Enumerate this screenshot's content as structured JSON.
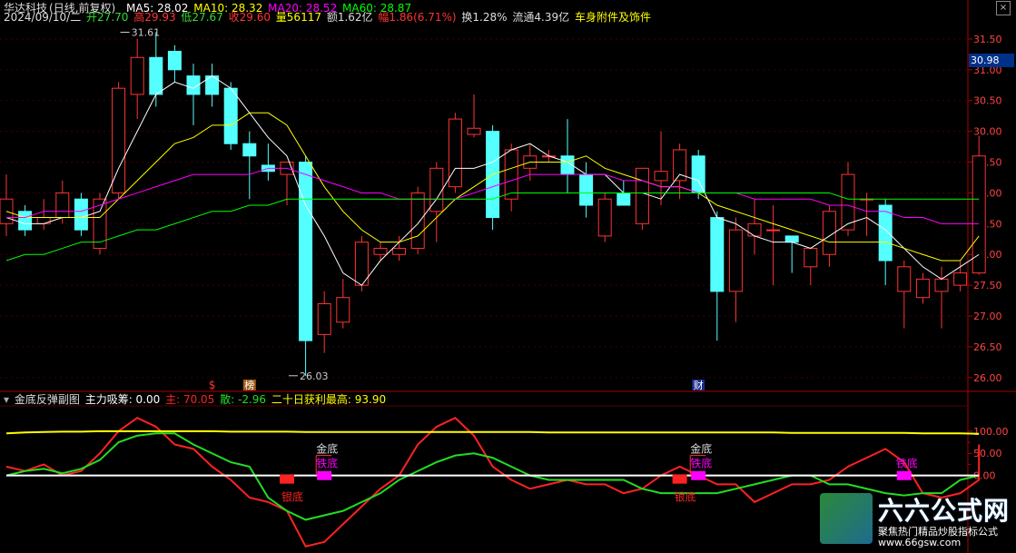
{
  "info_bar": {
    "stock_name": "华达科技",
    "mode": "(日线,前复权)",
    "ma5_label": "MA5: 28.02",
    "ma10_label": "MA10: 28.32",
    "ma20_label": "MA20: 28.52",
    "ma60_label": "MA60: 28.87",
    "date": "2024/09/10/二",
    "open": "开27.70",
    "high": "高29.93",
    "low": "低27.67",
    "close": "收29.60",
    "volume": "量56117",
    "amount": "额1.62亿",
    "change": "幅1.86(6.71%)",
    "turnover": "换1.28%",
    "float_cap": "流通4.39亿",
    "sector": "车身附件及饰件",
    "close_icon": "×"
  },
  "sub_bar": {
    "indicator": "金底反弹副图",
    "main_absorb": "主力吸筹: 0.00",
    "main": "主: 70.05",
    "scatter": "散: -2.96",
    "profit": "二十日获利最高: 93.90"
  },
  "current_price": "30.98",
  "markers": {
    "s_label": "$",
    "bang_label": "榜",
    "cai_label": "财"
  },
  "colors": {
    "up": "#ff3333",
    "down": "#54ffff",
    "ma5": "#ffffff",
    "ma10": "#ffff00",
    "ma20": "#ff00ff",
    "ma60": "#00ff00",
    "sub_red": "#ff2222",
    "sub_green": "#22dd22",
    "sub_yellow": "#ffff00",
    "sub_white": "#ffffff",
    "sub_magenta": "#ff00ff"
  },
  "watermark": {
    "title": "六六公式网",
    "subtitle": "聚焦热门精品炒股指标公式",
    "url": "www.66gsw.com"
  },
  "chart_data": [
    {
      "type": "candlestick",
      "y_ticks": [
        "31.50",
        "31.00",
        "30.50",
        "30.00",
        "29.50",
        "29.00",
        "28.50",
        "28.00",
        "27.50",
        "27.00",
        "26.50",
        "26.00"
      ],
      "ylim": [
        25.85,
        31.75
      ],
      "annotations": [
        {
          "text": "31.61",
          "candle": 6,
          "value": 31.61
        },
        {
          "text": "26.03",
          "candle": 15,
          "value": 26.03
        }
      ],
      "candles": [
        {
          "o": 28.5,
          "h": 29.3,
          "l": 28.3,
          "c": 28.9
        },
        {
          "o": 28.7,
          "h": 28.8,
          "l": 28.3,
          "c": 28.4
        },
        {
          "o": 28.5,
          "h": 28.9,
          "l": 28.4,
          "c": 28.6
        },
        {
          "o": 28.6,
          "h": 29.2,
          "l": 28.5,
          "c": 29.0
        },
        {
          "o": 28.9,
          "h": 29.0,
          "l": 28.3,
          "c": 28.4
        },
        {
          "o": 28.1,
          "h": 29.0,
          "l": 28.0,
          "c": 28.9
        },
        {
          "o": 29.0,
          "h": 30.8,
          "l": 28.9,
          "c": 30.7
        },
        {
          "o": 30.6,
          "h": 31.5,
          "l": 30.2,
          "c": 31.2
        },
        {
          "o": 31.2,
          "h": 31.61,
          "l": 30.4,
          "c": 30.6
        },
        {
          "o": 31.3,
          "h": 31.4,
          "l": 30.8,
          "c": 31.0
        },
        {
          "o": 30.9,
          "h": 31.1,
          "l": 30.1,
          "c": 30.6
        },
        {
          "o": 30.9,
          "h": 31.1,
          "l": 30.4,
          "c": 30.6
        },
        {
          "o": 30.7,
          "h": 30.8,
          "l": 29.7,
          "c": 29.8
        },
        {
          "o": 29.8,
          "h": 30.0,
          "l": 28.9,
          "c": 29.6
        },
        {
          "o": 29.45,
          "h": 29.8,
          "l": 29.2,
          "c": 29.35
        },
        {
          "o": 29.3,
          "h": 29.5,
          "l": 28.8,
          "c": 29.5
        },
        {
          "o": 29.5,
          "h": 29.6,
          "l": 26.03,
          "c": 26.6
        },
        {
          "o": 26.7,
          "h": 27.4,
          "l": 26.4,
          "c": 27.2
        },
        {
          "o": 26.9,
          "h": 27.6,
          "l": 26.8,
          "c": 27.3
        },
        {
          "o": 27.5,
          "h": 28.3,
          "l": 27.4,
          "c": 28.2
        },
        {
          "o": 28.0,
          "h": 28.2,
          "l": 27.9,
          "c": 28.1
        },
        {
          "o": 28.0,
          "h": 28.3,
          "l": 27.9,
          "c": 28.1
        },
        {
          "o": 28.1,
          "h": 29.1,
          "l": 28.0,
          "c": 29.0
        },
        {
          "o": 28.7,
          "h": 29.5,
          "l": 28.2,
          "c": 29.4
        },
        {
          "o": 29.1,
          "h": 30.3,
          "l": 29.0,
          "c": 30.2
        },
        {
          "o": 29.95,
          "h": 30.6,
          "l": 29.9,
          "c": 30.05
        },
        {
          "o": 30.0,
          "h": 30.1,
          "l": 28.4,
          "c": 28.6
        },
        {
          "o": 28.9,
          "h": 29.8,
          "l": 28.7,
          "c": 29.7
        },
        {
          "o": 29.4,
          "h": 29.8,
          "l": 29.2,
          "c": 29.6
        },
        {
          "o": 29.6,
          "h": 29.7,
          "l": 29.5,
          "c": 29.6
        },
        {
          "o": 29.6,
          "h": 30.2,
          "l": 29.0,
          "c": 29.3
        },
        {
          "o": 29.3,
          "h": 29.5,
          "l": 28.6,
          "c": 28.8
        },
        {
          "o": 28.3,
          "h": 29.0,
          "l": 28.2,
          "c": 28.9
        },
        {
          "o": 29.0,
          "h": 29.2,
          "l": 28.8,
          "c": 28.8
        },
        {
          "o": 28.5,
          "h": 29.4,
          "l": 28.4,
          "c": 29.4
        },
        {
          "o": 29.2,
          "h": 30.0,
          "l": 28.8,
          "c": 29.35
        },
        {
          "o": 29.2,
          "h": 29.8,
          "l": 28.9,
          "c": 29.7
        },
        {
          "o": 29.6,
          "h": 29.7,
          "l": 28.9,
          "c": 29.0
        },
        {
          "o": 28.6,
          "h": 28.7,
          "l": 26.6,
          "c": 27.4
        },
        {
          "o": 27.4,
          "h": 28.6,
          "l": 26.9,
          "c": 28.4
        },
        {
          "o": 28.3,
          "h": 28.9,
          "l": 28.0,
          "c": 28.5
        },
        {
          "o": 28.4,
          "h": 28.8,
          "l": 27.5,
          "c": 28.4
        },
        {
          "o": 28.3,
          "h": 28.3,
          "l": 27.7,
          "c": 28.2
        },
        {
          "o": 27.8,
          "h": 28.1,
          "l": 27.5,
          "c": 28.1
        },
        {
          "o": 28.0,
          "h": 28.8,
          "l": 27.8,
          "c": 28.7
        },
        {
          "o": 28.4,
          "h": 29.5,
          "l": 28.3,
          "c": 29.3
        },
        {
          "o": 28.9,
          "h": 29.0,
          "l": 28.3,
          "c": 28.9
        },
        {
          "o": 28.8,
          "h": 28.9,
          "l": 27.5,
          "c": 27.9
        },
        {
          "o": 27.4,
          "h": 27.9,
          "l": 26.8,
          "c": 27.8
        },
        {
          "o": 27.3,
          "h": 27.7,
          "l": 27.2,
          "c": 27.6
        },
        {
          "o": 27.4,
          "h": 27.8,
          "l": 26.8,
          "c": 27.6
        },
        {
          "o": 27.5,
          "h": 27.9,
          "l": 27.4,
          "c": 27.7
        },
        {
          "o": 27.7,
          "h": 29.93,
          "l": 27.67,
          "c": 29.6
        }
      ],
      "series": [
        {
          "name": "MA5",
          "values": [
            28.6,
            28.5,
            28.5,
            28.6,
            28.6,
            28.7,
            29.4,
            30.0,
            30.6,
            30.8,
            30.7,
            30.9,
            30.7,
            30.3,
            29.9,
            29.6,
            28.8,
            28.3,
            27.7,
            27.5,
            27.9,
            28.2,
            28.5,
            28.9,
            29.4,
            29.4,
            29.5,
            29.7,
            29.8,
            29.6,
            29.5,
            29.3,
            29.3,
            29.0,
            29.0,
            28.9,
            29.3,
            29.2,
            28.6,
            28.5,
            28.3,
            28.2,
            28.2,
            28.1,
            28.3,
            28.5,
            28.6,
            28.4,
            28.1,
            27.8,
            27.6,
            27.8,
            28.0
          ]
        },
        {
          "name": "MA10",
          "values": [
            28.7,
            28.6,
            28.6,
            28.6,
            28.6,
            28.6,
            28.9,
            29.2,
            29.5,
            29.8,
            29.9,
            30.1,
            30.1,
            30.3,
            30.3,
            30.1,
            29.6,
            29.1,
            28.7,
            28.4,
            28.2,
            28.2,
            28.3,
            28.6,
            28.9,
            29.1,
            29.3,
            29.4,
            29.5,
            29.5,
            29.5,
            29.6,
            29.4,
            29.3,
            29.2,
            29.1,
            29.1,
            29.0,
            28.8,
            28.7,
            28.6,
            28.5,
            28.4,
            28.3,
            28.2,
            28.2,
            28.2,
            28.2,
            28.1,
            28.0,
            27.9,
            27.9,
            28.3
          ]
        },
        {
          "name": "MA20",
          "values": [
            28.6,
            28.6,
            28.7,
            28.7,
            28.7,
            28.8,
            28.9,
            29.0,
            29.1,
            29.2,
            29.3,
            29.3,
            29.3,
            29.3,
            29.4,
            29.4,
            29.3,
            29.2,
            29.1,
            29.0,
            29.0,
            28.9,
            28.9,
            28.9,
            28.9,
            29.0,
            29.1,
            29.2,
            29.3,
            29.3,
            29.3,
            29.3,
            29.3,
            29.2,
            29.2,
            29.1,
            29.1,
            29.0,
            29.0,
            29.0,
            28.9,
            28.9,
            28.9,
            28.9,
            28.8,
            28.8,
            28.7,
            28.7,
            28.6,
            28.6,
            28.5,
            28.5,
            28.5
          ]
        },
        {
          "name": "MA60",
          "values": [
            27.9,
            28.0,
            28.0,
            28.1,
            28.2,
            28.2,
            28.3,
            28.4,
            28.4,
            28.5,
            28.6,
            28.7,
            28.7,
            28.8,
            28.8,
            28.9,
            28.9,
            28.9,
            28.9,
            28.9,
            28.9,
            28.9,
            28.9,
            28.9,
            28.9,
            28.9,
            28.9,
            29.0,
            29.0,
            29.0,
            29.0,
            29.0,
            29.0,
            29.0,
            29.0,
            29.0,
            29.0,
            29.0,
            29.0,
            29.0,
            29.0,
            29.0,
            29.0,
            29.0,
            29.0,
            28.9,
            28.9,
            28.9,
            28.9,
            28.9,
            28.9,
            28.9,
            28.9
          ]
        }
      ]
    },
    {
      "type": "line",
      "y_ticks": [
        "100.00",
        "50.00",
        "0.00"
      ],
      "ylim": [
        -175,
        155
      ],
      "series": [
        {
          "name": "主",
          "values": [
            20,
            10,
            25,
            0,
            10,
            50,
            100,
            130,
            110,
            70,
            60,
            20,
            -10,
            -50,
            -60,
            -80,
            -160,
            -150,
            -110,
            -70,
            -30,
            0,
            70,
            110,
            130,
            90,
            20,
            -10,
            -30,
            -20,
            -10,
            -20,
            -20,
            -40,
            -30,
            0,
            20,
            0,
            -20,
            -20,
            -60,
            -40,
            -20,
            -20,
            -10,
            20,
            40,
            60,
            30,
            -40,
            -50,
            -40,
            -10,
            70
          ]
        },
        {
          "name": "散",
          "values": [
            0,
            10,
            15,
            5,
            15,
            35,
            75,
            90,
            95,
            95,
            70,
            50,
            30,
            20,
            -50,
            -80,
            -100,
            -90,
            -80,
            -60,
            -40,
            -10,
            10,
            30,
            45,
            50,
            40,
            20,
            0,
            -10,
            -10,
            -10,
            -10,
            -10,
            -30,
            -40,
            -40,
            -40,
            -40,
            -30,
            -20,
            -10,
            0,
            0,
            -20,
            -20,
            -30,
            -40,
            -45,
            -40,
            -40,
            -10,
            0
          ]
        },
        {
          "name": "二十日获利最高",
          "values": [
            95,
            97,
            98,
            99,
            99,
            100,
            100,
            100,
            100,
            100,
            100,
            100,
            99,
            99,
            99,
            99,
            98,
            98,
            98,
            98,
            98,
            98,
            98,
            98,
            98,
            98,
            98,
            98,
            98,
            97,
            97,
            97,
            97,
            97,
            97,
            97,
            97,
            97,
            97,
            97,
            97,
            97,
            96,
            96,
            96,
            96,
            96,
            96,
            96,
            95,
            95,
            95,
            94
          ]
        },
        {
          "name": "主力吸筹",
          "values": [
            0,
            0,
            0,
            0,
            0,
            0,
            0,
            0,
            0,
            0,
            0,
            0,
            0,
            0,
            0,
            0,
            0,
            0,
            0,
            0,
            0,
            0,
            0,
            0,
            0,
            0,
            0,
            0,
            0,
            0,
            0,
            0,
            0,
            0,
            0,
            0,
            0,
            0,
            0,
            0,
            0,
            0,
            0,
            0,
            0,
            0,
            0,
            0,
            0,
            0,
            0,
            0,
            0
          ]
        }
      ],
      "signals": [
        {
          "text": "银底",
          "candle": 15,
          "color": "#ff2222"
        },
        {
          "text": "金底",
          "candle": 17
        },
        {
          "text": "铁底",
          "candle": 17
        },
        {
          "text": "银底",
          "candle": 36,
          "color": "#ff2222"
        },
        {
          "text": "金底",
          "candle": 37
        },
        {
          "text": "铁底",
          "candle": 37
        },
        {
          "text": "铁底",
          "candle": 48
        }
      ]
    }
  ]
}
